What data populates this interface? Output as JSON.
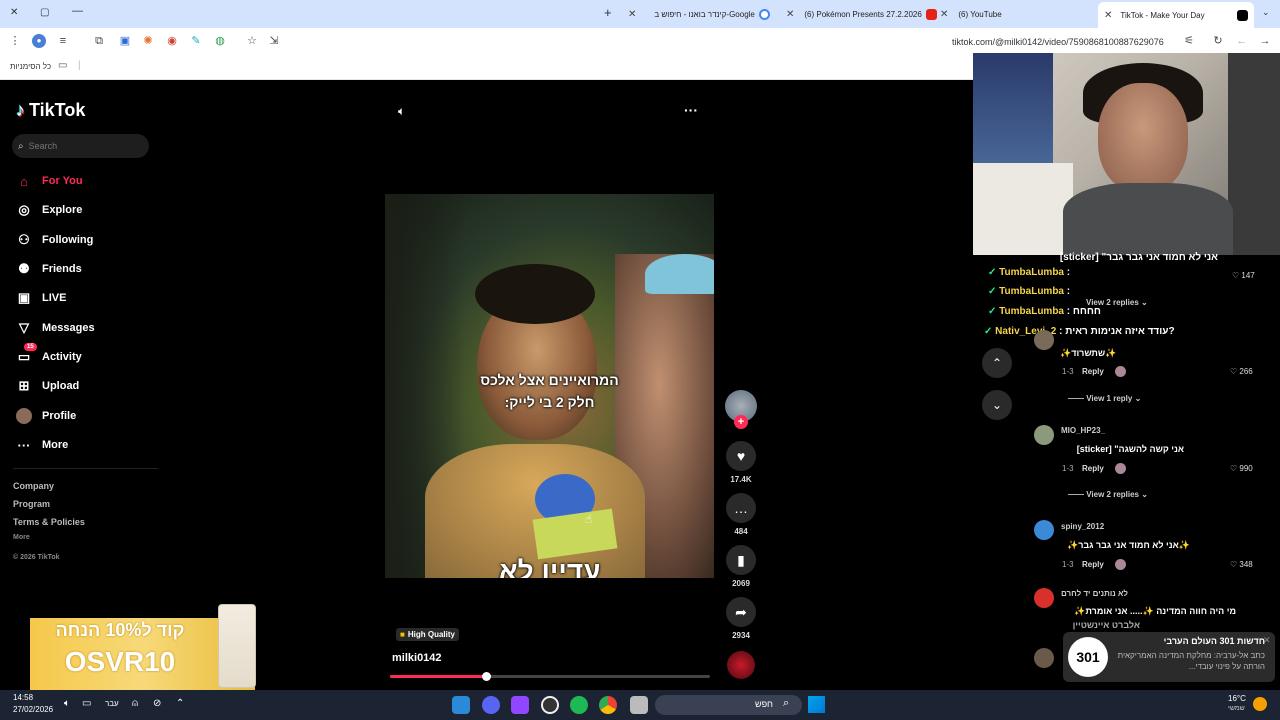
{
  "browser": {
    "tabs": [
      {
        "label": "TikTok - Make Your Day",
        "active": true
      },
      {
        "label": "(6) YouTube",
        "active": false
      },
      {
        "label": "(6) Pokémon Presents 27.2.2026",
        "active": false
      },
      {
        "label": "קינדר בואנו - חיפוש ב-Google",
        "active": false
      }
    ],
    "url": "tiktok.com/@milki0142/video/7590868100887629076",
    "bookmarks_label": "כל הסימניות"
  },
  "tiktok": {
    "logo": "TikTok",
    "search_placeholder": "Search",
    "nav": [
      {
        "label": "For You",
        "icon": "home-icon"
      },
      {
        "label": "Explore",
        "icon": "compass-icon"
      },
      {
        "label": "Following",
        "icon": "following-icon"
      },
      {
        "label": "Friends",
        "icon": "friends-icon"
      },
      {
        "label": "LIVE",
        "icon": "live-icon"
      },
      {
        "label": "Messages",
        "icon": "messages-icon"
      },
      {
        "label": "Activity",
        "icon": "activity-icon",
        "badge": "15"
      },
      {
        "label": "Upload",
        "icon": "upload-icon"
      },
      {
        "label": "Profile",
        "icon": "avatar"
      },
      {
        "label": "More",
        "icon": "more-icon"
      }
    ],
    "footer": {
      "company": "Company",
      "program": "Program",
      "terms": "Terms & Policies",
      "more": "More",
      "copyright": "© 2026 TikTok"
    },
    "ad": {
      "line1": "קוד ל10% הנחה",
      "line2": "OSVR10"
    }
  },
  "video": {
    "caption_line1": "המרואיינים אצל אלכס",
    "caption_line2": "חלק 2 בי לייק:",
    "bottom_text": "עדיין לא",
    "quality_badge": "High Quality",
    "username": "milki0142",
    "progress": 0.3,
    "actions": {
      "likes": "17.4K",
      "comments": "484",
      "saves": "2069",
      "shares": "2934"
    }
  },
  "chat_overlay": [
    {
      "text": "אני לא חמוד אני גבר גבר\" [sticker]",
      "color": "#ffffff"
    },
    {
      "user": "TumbaLumba",
      "text": ":",
      "color": "#f5d34a"
    },
    {
      "user": "TumbaLumba",
      "text": ":",
      "color": "#f5d34a"
    },
    {
      "user": "TumbaLumba",
      "text": ": חחחח",
      "color": "#f5d34a"
    },
    {
      "user": "Nativ_Levi_2",
      "text": ": עודד איזה אנימות ראית?",
      "color": "#f5d34a"
    }
  ],
  "comments": {
    "top_like": "147",
    "view_replies_2": "View 2 replies",
    "c1": {
      "text": "✨שתשרוד✨",
      "date": "1-3",
      "reply": "Reply",
      "likes": "266",
      "view": "View 1 reply"
    },
    "c2": {
      "user": "MIO_HP23_",
      "text": "אני קשה להשגה\" [sticker]",
      "date": "1-3",
      "reply": "Reply",
      "likes": "990",
      "view": "View 2 replies"
    },
    "c3": {
      "user": "spiny_2012",
      "text": "✨אני לא חמוד אני גבר גבר✨",
      "date": "1-3",
      "reply": "Reply",
      "likes": "348"
    },
    "c4": {
      "user": "לא נותנים יד לחרם",
      "text": "מי היה חווה המדינה ✨..... אני אומרת✨",
      "text2": "אלברט איינשטיין"
    }
  },
  "notification": {
    "title": "חדשות 301 העולם הערבי",
    "body": "כתב אל-ערביה: מחלקת המדינה האמריקאית הורתה על פינוי עובדי...",
    "logo": "301"
  },
  "taskbar": {
    "time": "14:58",
    "date": "27/02/2026",
    "lang": "עבר",
    "search": "חפש",
    "weather": "16°C",
    "weather_label": "שמשי"
  }
}
